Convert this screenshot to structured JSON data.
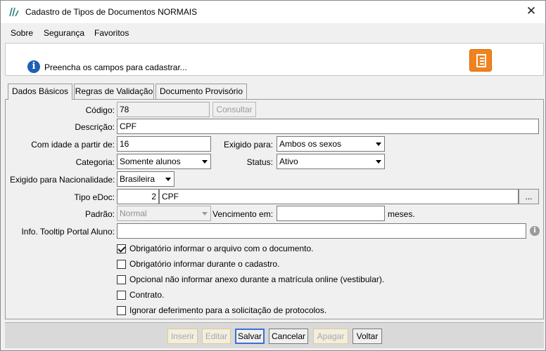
{
  "window": {
    "title": "Cadastro de Tipos de Documentos NORMAIS",
    "close_glyph": "✕"
  },
  "menu": [
    {
      "label": "Sobre"
    },
    {
      "label": "Segurança"
    },
    {
      "label": "Favoritos"
    }
  ],
  "header": {
    "message": "Preencha os campos para cadastrar..."
  },
  "tabs": [
    {
      "label": "Dados Básicos",
      "active": true
    },
    {
      "label": "Regras de Validação",
      "active": false
    },
    {
      "label": "Documento Provisório",
      "active": false
    }
  ],
  "form": {
    "codigo_label": "Código:",
    "codigo_value": "78",
    "consultar_label": "Consultar",
    "descricao_label": "Descrição:",
    "descricao_value": "CPF",
    "idade_label": "Com idade a partir de:",
    "idade_value": "16",
    "exigido_label": "Exigido para:",
    "exigido_value": "Ambos os sexos",
    "categoria_label": "Categoria:",
    "categoria_value": "Somente alunos",
    "status_label": "Status:",
    "status_value": "Ativo",
    "nacionalidade_label": "Exigido para Nacionalidade:",
    "nacionalidade_value": "Brasileira",
    "tipo_edoc_label": "Tipo eDoc:",
    "tipo_edoc_code": "2",
    "tipo_edoc_name": "CPF",
    "browse_label": "...",
    "padrao_label": "Padrão:",
    "padrao_value": "Normal",
    "vencimento_label": "Vencimento em:",
    "vencimento_value": "",
    "meses_label": "meses.",
    "tooltip_label": "Info. Tooltip Portal Aluno:",
    "tooltip_value": ""
  },
  "checkboxes": [
    {
      "label": "Obrigatório informar o arquivo com o documento.",
      "checked": true
    },
    {
      "label": "Obrigatório informar durante o cadastro.",
      "checked": false
    },
    {
      "label": "Opcional não informar anexo durante a matrícula online (vestibular).",
      "checked": false
    },
    {
      "label": "Contrato.",
      "checked": false
    },
    {
      "label": "Ignorar deferimento para a solicitação de protocolos.",
      "checked": false
    }
  ],
  "footer": {
    "buttons": [
      {
        "label": "Inserir",
        "enabled": false
      },
      {
        "label": "Editar",
        "enabled": false
      },
      {
        "label": "Salvar",
        "enabled": true
      },
      {
        "label": "Cancelar",
        "enabled": true
      },
      {
        "label": "Apagar",
        "enabled": false
      },
      {
        "label": "Voltar",
        "enabled": true
      }
    ]
  },
  "colors": {
    "accent_orange": "#f0831e",
    "info_blue": "#1f5fb4",
    "focus_blue": "#3a6fd8"
  }
}
